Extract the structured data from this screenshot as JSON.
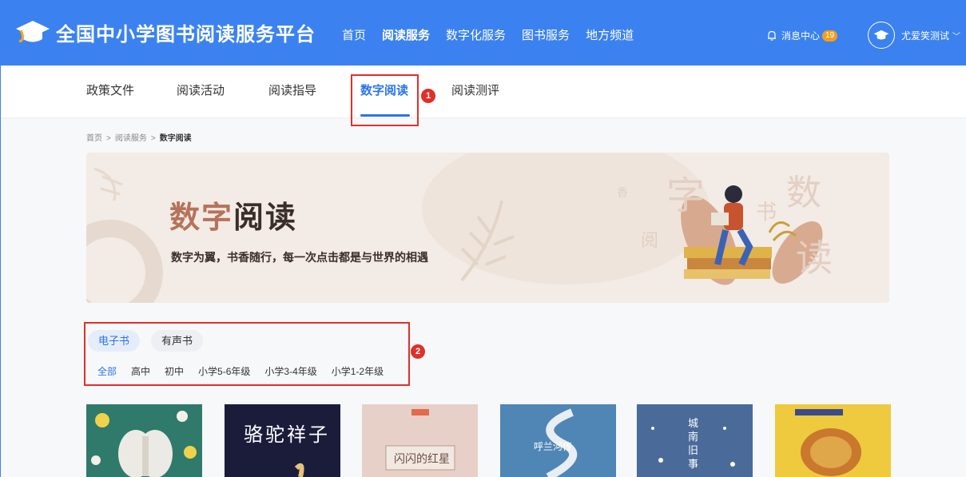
{
  "header": {
    "site_title": "全国中小学图书阅读服务平台",
    "nav": [
      {
        "label": "首页"
      },
      {
        "label": "阅读服务"
      },
      {
        "label": "数字化服务"
      },
      {
        "label": "图书服务"
      },
      {
        "label": "地方频道"
      }
    ],
    "active_nav": "阅读服务",
    "message_center": "消息中心",
    "message_count": "19",
    "user_name": "尤爱笑测试",
    "brand_color": "#3b82f0"
  },
  "subnav": {
    "items": [
      {
        "label": "政策文件"
      },
      {
        "label": "阅读活动"
      },
      {
        "label": "阅读指导"
      },
      {
        "label": "数字阅读"
      },
      {
        "label": "阅读测评"
      }
    ],
    "active": "数字阅读",
    "accent_color": "#2b74e8"
  },
  "annotations": [
    "1",
    "2"
  ],
  "breadcrumb": [
    "首页",
    "阅读服务",
    "数字阅读"
  ],
  "banner": {
    "title_accent": "数字",
    "title_rest": "阅读",
    "subtitle": "数字为翼，书香随行，每一次点击都是与世界的相遇",
    "deco_chars": [
      "字",
      "数",
      "书",
      "香",
      "阅",
      "读"
    ]
  },
  "filters": {
    "tabs": [
      {
        "label": "电子书"
      },
      {
        "label": "有声书"
      }
    ],
    "active_tab": "电子书",
    "grades": [
      {
        "label": "全部"
      },
      {
        "label": "高中"
      },
      {
        "label": "初中"
      },
      {
        "label": "小学5-6年级"
      },
      {
        "label": "小学3-4年级"
      },
      {
        "label": "小学1-2年级"
      }
    ],
    "active_grade": "全部"
  },
  "books": [
    {
      "cover_title": "",
      "cover_color": "#2f7a6b"
    },
    {
      "cover_title": "骆驼祥子",
      "cover_color": "#1a1c3a"
    },
    {
      "cover_title": "闪闪的红星",
      "cover_color": "#e8d6cf"
    },
    {
      "cover_title": "呼兰河传",
      "cover_color": "#4f86b5"
    },
    {
      "cover_title": "城南旧事",
      "cover_color": "#4a6a9a"
    },
    {
      "cover_title": "",
      "cover_color": "#e9c23a"
    }
  ]
}
